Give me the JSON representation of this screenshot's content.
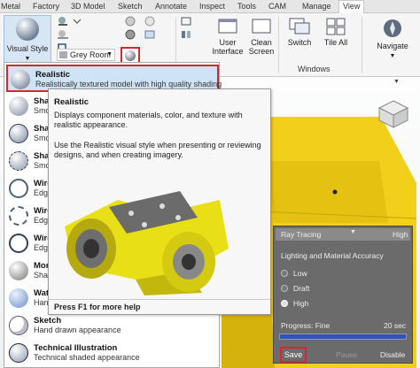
{
  "tabs": [
    "Metal",
    "Factory",
    "3D Model",
    "Sketch",
    "Annotate",
    "Inspect",
    "Tools",
    "CAM",
    "Manage",
    "View"
  ],
  "ribbon": {
    "visual_style_label": "Visual Style",
    "grey_room_label": "Grey Room",
    "user_interface_label": "User\nInterface",
    "clean_screen_label": "Clean\nScreen",
    "switch_label": "Switch",
    "tile_all_label": "Tile All",
    "navigate_label": "Navigate",
    "windows_panel_label": "Windows"
  },
  "dropdown": {
    "items": [
      {
        "title": "Realistic",
        "desc": "Realistically textured model with high quality shading",
        "selected": true,
        "icon": "realistic-sphere-icon"
      },
      {
        "title": "Shad",
        "desc": "Smo",
        "icon": "shaded-sphere-icon"
      },
      {
        "title": "Shad",
        "desc": "Smo",
        "icon": "shaded-edges-sphere-icon"
      },
      {
        "title": "Shad",
        "desc": "Smo",
        "icon": "shaded-hidden-sphere-icon"
      },
      {
        "title": "Wire",
        "desc": "Edge",
        "icon": "wireframe-sphere-icon"
      },
      {
        "title": "Wire",
        "desc": "Edge",
        "icon": "wireframe-hidden-sphere-icon"
      },
      {
        "title": "Wire",
        "desc": "Edge",
        "icon": "wireframe-visible-sphere-icon"
      },
      {
        "title": "Mono",
        "desc": "Shad",
        "icon": "monochrome-sphere-icon"
      },
      {
        "title": "Wate",
        "desc": "Hand",
        "icon": "watercolor-sphere-icon"
      },
      {
        "title": "Sketch",
        "desc": "Hand drawn appearance",
        "icon": "sketch-sphere-icon"
      },
      {
        "title": "Technical Illustration",
        "desc": "Technical shaded appearance",
        "icon": "technical-sphere-icon"
      }
    ]
  },
  "tooltip": {
    "title": "Realistic",
    "line1": "Displays component materials, color, and texture with realistic appearance.",
    "line2": "Use the Realistic visual style when presenting or reviewing designs, and when creating imagery.",
    "footer": "Press F1 for more help"
  },
  "ray_tracing": {
    "title": "Ray Tracing",
    "quality_value": "High",
    "section_label": "Lighting and Material Accuracy",
    "options": [
      "Low",
      "Draft",
      "High"
    ],
    "selected_option": "High",
    "progress_label": "Progress: Fine",
    "progress_time": "20 sec",
    "progress_fraction": 1.0,
    "save_label": "Save",
    "pause_label": "Pause",
    "disable_label": "Disable"
  },
  "colors": {
    "accent_red": "#d9262e",
    "progress_blue": "#2d54c0",
    "model_yellow": "#f1cf1a"
  }
}
